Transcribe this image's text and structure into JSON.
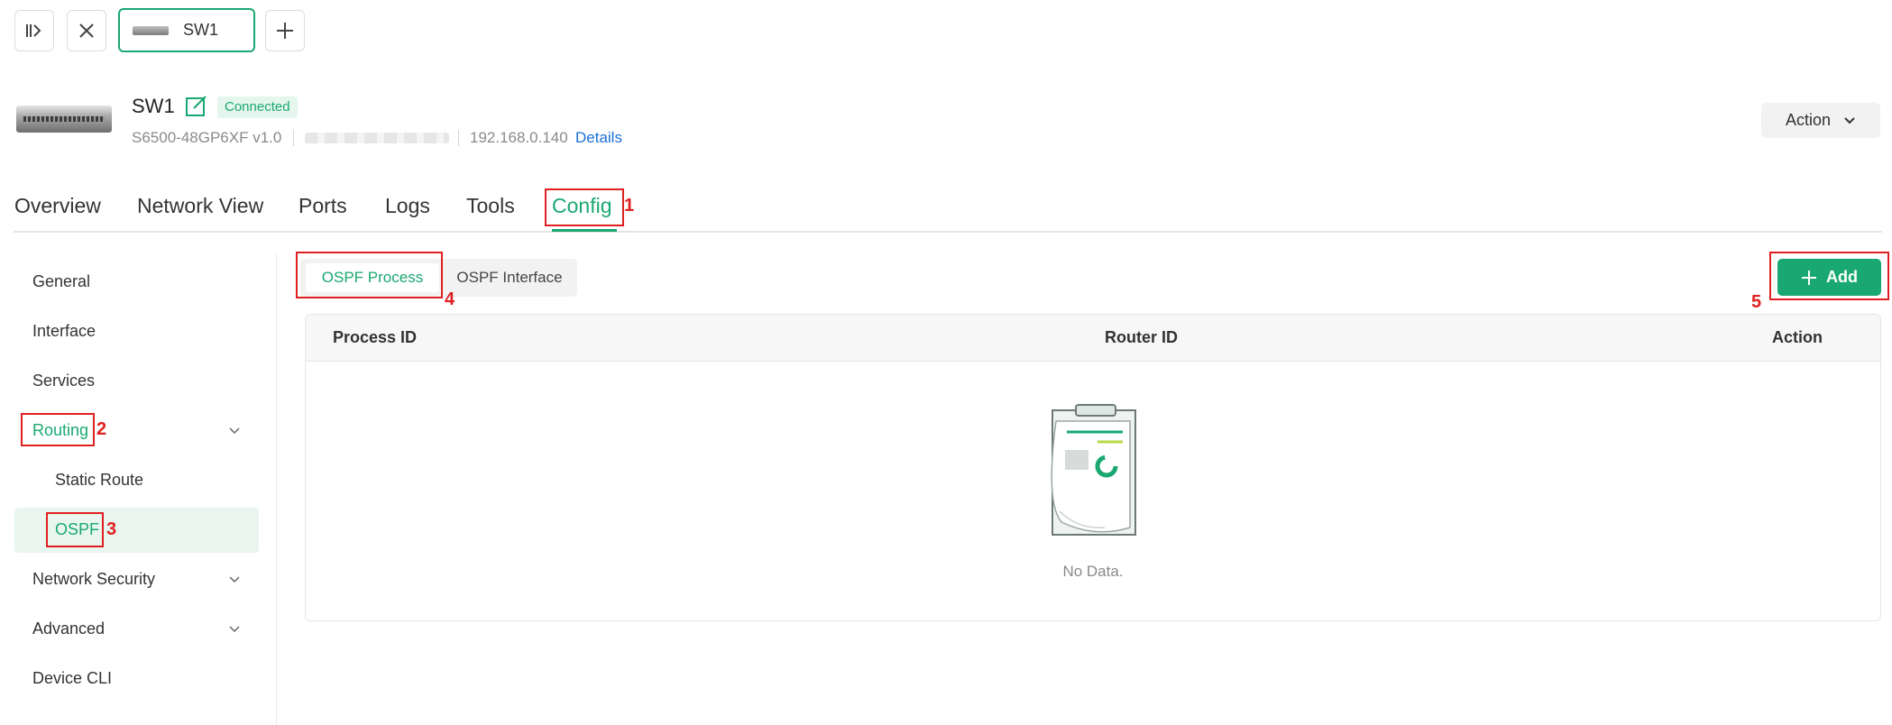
{
  "tabbar": {
    "device_tab_label": "SW1"
  },
  "device": {
    "name": "SW1",
    "status": "Connected",
    "model": "S6500-48GP6XF v1.0",
    "ip": "192.168.0.140",
    "details_link": "Details",
    "action_label": "Action"
  },
  "main_tabs": [
    {
      "label": "Overview"
    },
    {
      "label": "Network View"
    },
    {
      "label": "Ports"
    },
    {
      "label": "Logs"
    },
    {
      "label": "Tools"
    },
    {
      "label": "Config"
    }
  ],
  "sidebar": {
    "items": [
      {
        "label": "General"
      },
      {
        "label": "Interface"
      },
      {
        "label": "Services"
      },
      {
        "label": "Routing"
      },
      {
        "label": "Static Route"
      },
      {
        "label": "OSPF"
      },
      {
        "label": "Network Security"
      },
      {
        "label": "Advanced"
      },
      {
        "label": "Device CLI"
      }
    ]
  },
  "subtabs": [
    {
      "label": "OSPF Process"
    },
    {
      "label": "OSPF Interface"
    }
  ],
  "add_button": "Add",
  "table": {
    "columns": [
      "Process ID",
      "Router ID",
      "Action"
    ],
    "empty_text": "No Data."
  },
  "annotations": [
    "1",
    "2",
    "3",
    "4",
    "5"
  ],
  "colors": {
    "accent": "#1aa872",
    "link": "#1a6fd1",
    "annotation": "#e02020"
  }
}
